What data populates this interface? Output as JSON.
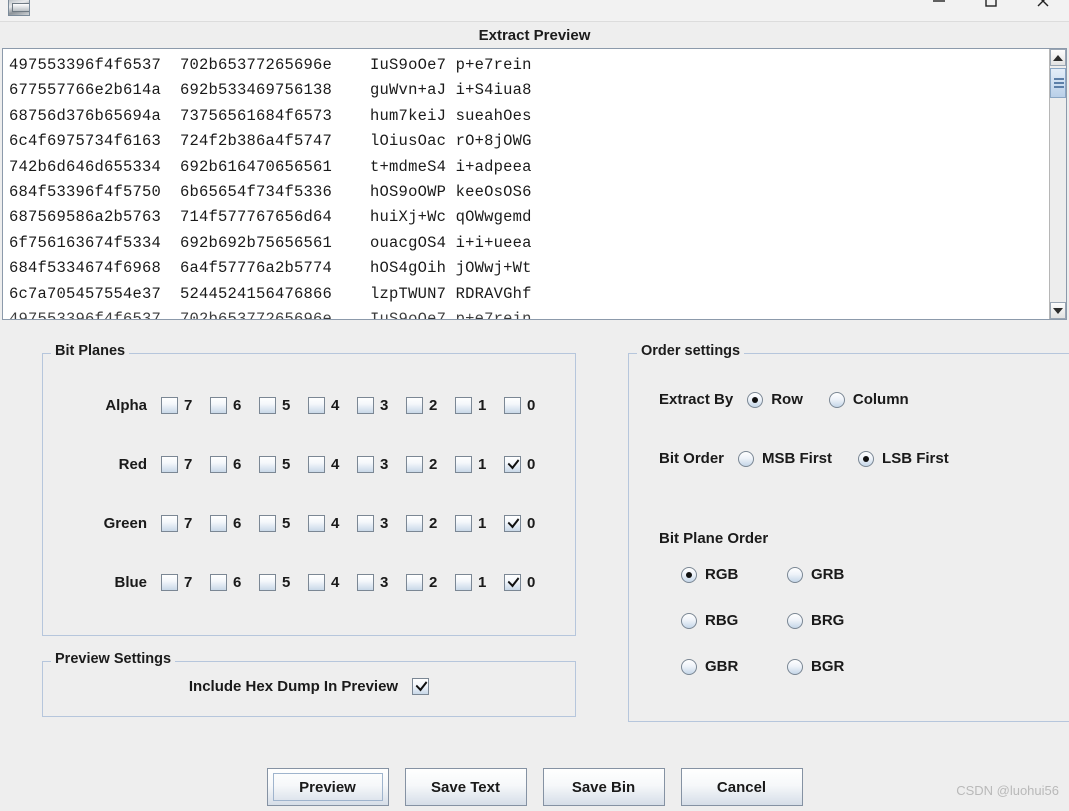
{
  "window": {
    "app_icon": "image-app-icon",
    "controls": [
      {
        "name": "minimize-button",
        "glyph": "minimize-icon"
      },
      {
        "name": "maximize-button",
        "glyph": "maximize-icon"
      },
      {
        "name": "close-button",
        "glyph": "close-icon"
      }
    ]
  },
  "dialog": {
    "title": "Extract Preview"
  },
  "preview": {
    "lines": [
      "497553396f4f6537  702b65377265696e    IuS9oOe7 p+e7rein",
      "677557766e2b614a  692b533469756138    guWvn+aJ i+S4iua8",
      "68756d376b65694a  73756561684f6573    hum7keiJ sueahOes",
      "6c4f6975734f6163  724f2b386a4f5747    lOiusOac rO+8jOWG",
      "742b6d646d655334  692b616470656561    t+mdmeS4 i+adpeea",
      "684f53396f4f5750  6b65654f734f5336    hOS9oOWP keeOsOS6",
      "687569586a2b5763  714f577767656d64    huiXj+Wc qOWwgemd",
      "6f756163674f5334  692b692b75656561    ouacgOS4 i+i+ueea",
      "684f5334674f6968  6a4f57776a2b5774    hOS4gOih jOWwj+Wt",
      "6c7a705457554e37  5244524156476866    lzpTWUN7 RDRAVGhf"
    ],
    "scrollbar": {
      "up_arrow": "scroll-up-icon",
      "down_arrow": "scroll-down-icon"
    }
  },
  "bit_planes": {
    "legend": "Bit Planes",
    "bits": [
      "7",
      "6",
      "5",
      "4",
      "3",
      "2",
      "1",
      "0"
    ],
    "rows": [
      {
        "label": "Alpha",
        "checked": [
          false,
          false,
          false,
          false,
          false,
          false,
          false,
          false
        ]
      },
      {
        "label": "Red",
        "checked": [
          false,
          false,
          false,
          false,
          false,
          false,
          false,
          true
        ]
      },
      {
        "label": "Green",
        "checked": [
          false,
          false,
          false,
          false,
          false,
          false,
          false,
          true
        ]
      },
      {
        "label": "Blue",
        "checked": [
          false,
          false,
          false,
          false,
          false,
          false,
          false,
          true
        ]
      }
    ]
  },
  "preview_settings": {
    "legend": "Preview Settings",
    "include_hex_dump_label": "Include Hex Dump In Preview",
    "include_hex_dump_checked": true
  },
  "order_settings": {
    "legend": "Order settings",
    "extract_by": {
      "label": "Extract By",
      "options": [
        {
          "label": "Row",
          "selected": true
        },
        {
          "label": "Column",
          "selected": false
        }
      ]
    },
    "bit_order": {
      "label": "Bit Order",
      "options": [
        {
          "label": "MSB First",
          "selected": false
        },
        {
          "label": "LSB First",
          "selected": true
        }
      ]
    },
    "bit_plane_order": {
      "label": "Bit Plane Order",
      "options": [
        {
          "label": "RGB",
          "selected": true
        },
        {
          "label": "GRB",
          "selected": false
        },
        {
          "label": "RBG",
          "selected": false
        },
        {
          "label": "BRG",
          "selected": false
        },
        {
          "label": "GBR",
          "selected": false
        },
        {
          "label": "BGR",
          "selected": false
        }
      ]
    }
  },
  "buttons": [
    {
      "label": "Preview",
      "focused": true
    },
    {
      "label": "Save Text",
      "focused": false
    },
    {
      "label": "Save Bin",
      "focused": false
    },
    {
      "label": "Cancel",
      "focused": false
    }
  ],
  "watermark": "CSDN @luohui56",
  "colors": {
    "window_bg": "#eeeeee",
    "panel_border": "#b6c6dc",
    "text": "#1a1a1a",
    "field_bg": "#ffffff",
    "field_border": "#8c9aab",
    "scroll_thumb": "#b9cfe8",
    "watermark": "#b9b9b9"
  }
}
